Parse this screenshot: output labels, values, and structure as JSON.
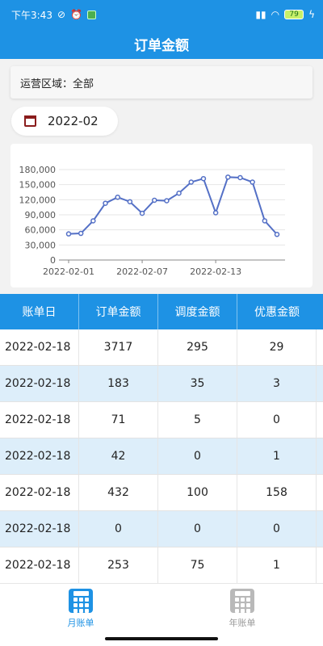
{
  "status_bar": {
    "time": "下午3:43",
    "battery": "79"
  },
  "header": {
    "title": "订单金额"
  },
  "filter": {
    "region_text": "运营区域：全部"
  },
  "date_selector": {
    "value": "2022-02",
    "icon": "calendar-icon"
  },
  "chart_data": {
    "type": "line",
    "x": [
      "2022-02-01",
      "2022-02-02",
      "2022-02-03",
      "2022-02-04",
      "2022-02-05",
      "2022-02-06",
      "2022-02-07",
      "2022-02-08",
      "2022-02-09",
      "2022-02-10",
      "2022-02-11",
      "2022-02-12",
      "2022-02-13",
      "2022-02-14",
      "2022-02-15",
      "2022-02-16",
      "2022-02-17",
      "2022-02-18"
    ],
    "series": [
      {
        "values": [
          52000,
          53000,
          78000,
          113000,
          125000,
          116000,
          93000,
          119000,
          118000,
          133000,
          155000,
          162000,
          94000,
          165000,
          164000,
          155000,
          78000,
          51000
        ],
        "color": "#5470c6"
      }
    ],
    "ylim": [
      0,
      180000
    ],
    "yticks": [
      "0",
      "30,000",
      "60,000",
      "90,000",
      "120,000",
      "150,000",
      "180,000"
    ],
    "xticks": [
      "2022-02-01",
      "2022-02-07",
      "2022-02-13"
    ],
    "grid": true
  },
  "table": {
    "headers": [
      "账单日",
      "订单金额",
      "调度金额",
      "优惠金额"
    ],
    "rows": [
      [
        "2022-02-18",
        "3717",
        "295",
        "29"
      ],
      [
        "2022-02-18",
        "183",
        "35",
        "3"
      ],
      [
        "2022-02-18",
        "71",
        "5",
        "0"
      ],
      [
        "2022-02-18",
        "42",
        "0",
        "1"
      ],
      [
        "2022-02-18",
        "432",
        "100",
        "158"
      ],
      [
        "2022-02-18",
        "0",
        "0",
        "0"
      ],
      [
        "2022-02-18",
        "253",
        "75",
        "1"
      ]
    ]
  },
  "tabbar": {
    "items": [
      {
        "label": "月账单",
        "icon": "calculator-icon",
        "active": true
      },
      {
        "label": "年账单",
        "icon": "calculator-icon",
        "active": false
      }
    ]
  },
  "colors": {
    "accent": "#1e92e4",
    "row_alt": "#ddeefa",
    "line": "#5470c6"
  }
}
